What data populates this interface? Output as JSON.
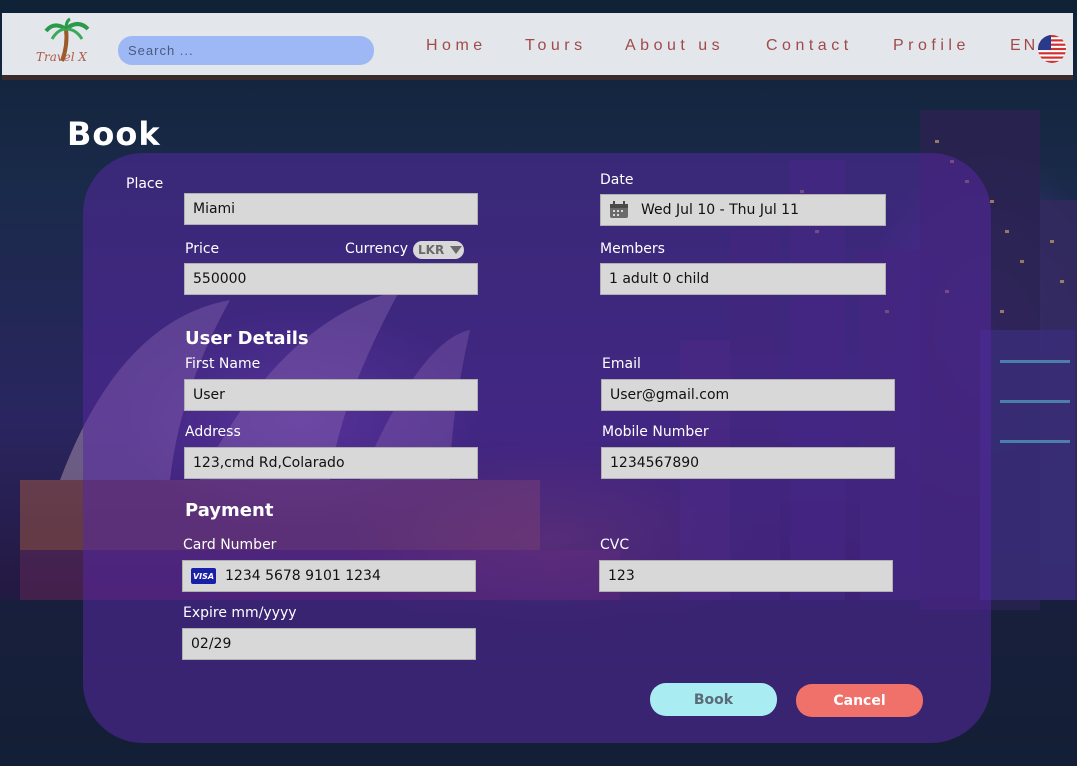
{
  "app": {
    "logo_text": "Travel X"
  },
  "search": {
    "placeholder": "Search ..."
  },
  "nav": {
    "items": [
      "Home",
      "Tours",
      "About us",
      "Contact",
      "Profile"
    ],
    "language": "EN"
  },
  "page": {
    "title": "Book"
  },
  "trip": {
    "place_label": "Place",
    "place_value": "Miami",
    "date_label": "Date",
    "date_value": "Wed Jul 10 - Thu Jul 11",
    "price_label": "Price",
    "price_value": "550000",
    "currency_label": "Currency",
    "currency_value": "LKR",
    "members_label": "Members",
    "members_value": "1 adult  0 child"
  },
  "user": {
    "section_title": "User Details",
    "first_name_label": "First Name",
    "first_name_value": "User",
    "email_label": "Email",
    "email_value": "User@gmail.com",
    "address_label": "Address",
    "address_value": "123,cmd Rd,Colarado",
    "mobile_label": "Mobile Number",
    "mobile_value": "1234567890"
  },
  "payment": {
    "section_title": "Payment",
    "card_label": "Card Number",
    "card_brand": "VISA",
    "card_value": "1234 5678 9101 1234",
    "cvc_label": "CVC",
    "cvc_value": "123",
    "expire_label": "Expire  mm/yyyy",
    "expire_value": "02/29"
  },
  "actions": {
    "book_label": "Book",
    "cancel_label": "Cancel"
  },
  "colors": {
    "nav_text": "#a14a4a",
    "search_bg": "#9db8f4",
    "panel_bg": "#5528a0",
    "book_button": "#a9ecf2",
    "cancel_button": "#f0706a"
  },
  "icons": [
    "palm-tree-icon",
    "us-flag-icon",
    "calendar-icon",
    "visa-card-icon",
    "chevron-down-icon"
  ]
}
